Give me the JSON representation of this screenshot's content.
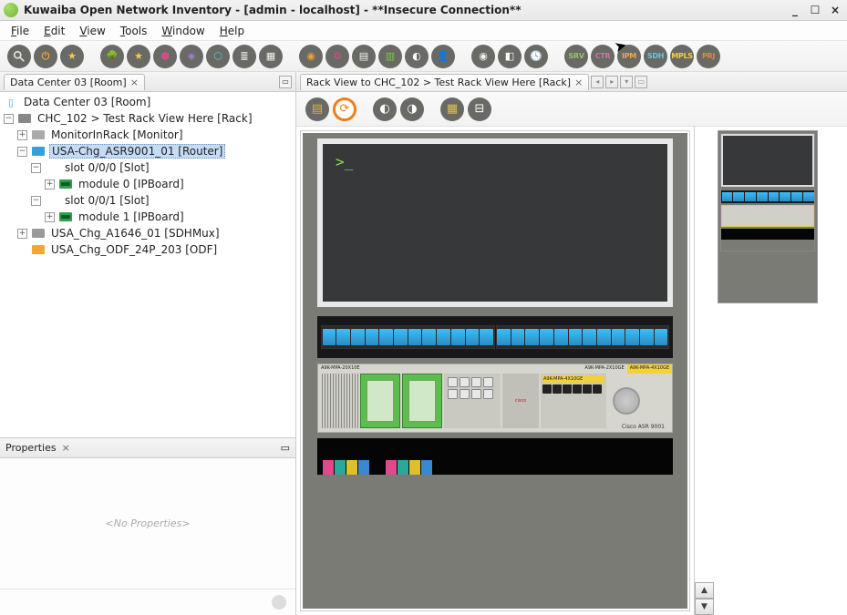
{
  "window": {
    "title": "Kuwaiba Open Network Inventory - [admin - localhost] - **Insecure Connection**",
    "min": "_",
    "max": "☐",
    "close": "×"
  },
  "menu": {
    "file": "File",
    "edit": "Edit",
    "view": "View",
    "tools": "Tools",
    "window": "Window",
    "help": "Help"
  },
  "toolbar_labels": {
    "srv": "SRV",
    "ctr": "CTR",
    "ipm": "IPM",
    "sdh": "SDH",
    "mpls": "MPLS",
    "prj": "PRJ"
  },
  "left": {
    "tab": "Data Center 03 [Room]",
    "tree": {
      "root": "Data Center 03 [Room]",
      "rack": "CHC_102 > Test Rack View Here [Rack]",
      "monitor": "MonitorInRack [Monitor]",
      "router": "USA-Chg_ASR9001_01 [Router]",
      "slot000": "slot 0/0/0 [Slot]",
      "module0": "module 0 [IPBoard]",
      "slot001": "slot 0/0/1 [Slot]",
      "module1": "module 1 [IPBoard]",
      "mux": "USA_Chg_A1646_01 [SDHMux]",
      "odf": "USA_Chg_ODF_24P_203 [ODF]"
    }
  },
  "properties": {
    "title": "Properties",
    "empty": "<No Properties>"
  },
  "right": {
    "tab": "Rack View to CHC_102 > Test Rack View Here [Rack]",
    "terminal_prompt": ">_",
    "cisco1": "cisco",
    "cisco2": "Cisco ASR 9001",
    "card_label1": "A9K-MPA-20X10E",
    "card_label2": "A9K-MPA-2X10GE",
    "card_label3": "A9K-MPA-4X10GE"
  }
}
